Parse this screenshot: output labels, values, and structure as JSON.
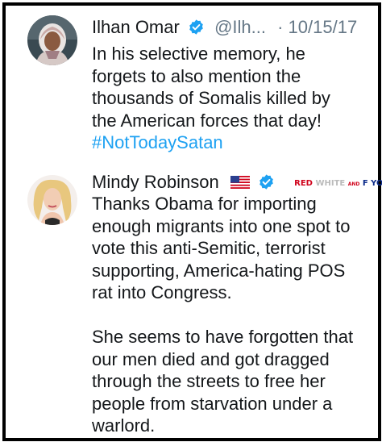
{
  "tweets": [
    {
      "name": "Ilhan Omar",
      "handle": "@Ilh...",
      "date": "· 10/15/17",
      "lines": [
        "In his selective memory, he",
        "forgets to also mention the",
        "thousands of Somalis killed by",
        "the American forces that day!"
      ],
      "hashtag": "#NotTodaySatan"
    },
    {
      "name": "Mindy Robinson",
      "banner": {
        "red": "RED",
        "white": "WHITE",
        "and": "AND",
        "fyou": "F YOU!"
      },
      "paragraph1": [
        "Thanks Obama for importing",
        "enough migrants into one spot to",
        "vote this anti-Semitic, terrorist",
        "supporting, America-hating POS",
        "rat into Congress."
      ],
      "paragraph2": [
        "She seems to have forgotten that",
        "our men died and got dragged",
        "through the streets to free her",
        "people from starvation under a",
        "warlord."
      ]
    }
  ],
  "colors": {
    "text": "#14171a",
    "secondary": "#657786",
    "link": "#1da1f2",
    "verified": "#1da1f2",
    "frame": "#000000"
  },
  "icons": [
    "verified-badge-icon",
    "us-flag-emoji"
  ]
}
